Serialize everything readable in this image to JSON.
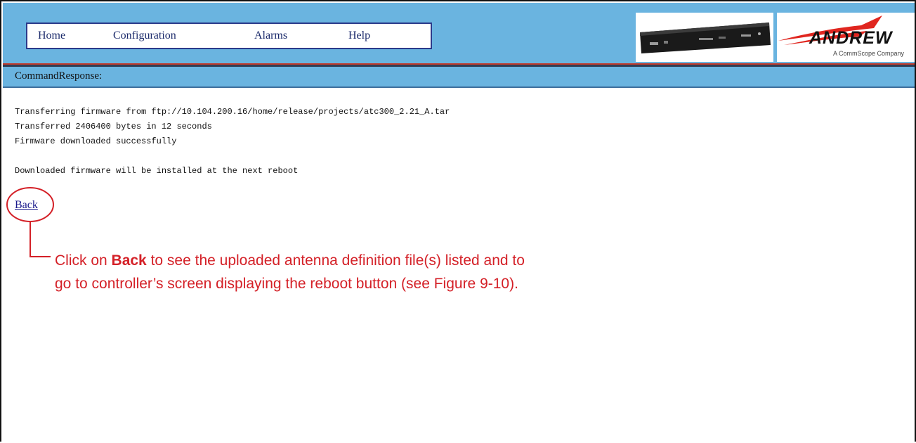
{
  "nav": {
    "home": "Home",
    "configuration": "Configuration",
    "alarms": "Alarms",
    "help": "Help"
  },
  "logo": {
    "brand": "ANDREW",
    "tagline": "A CommScope Company"
  },
  "command_response": {
    "label": "CommandResponse:",
    "lines": [
      "Transferring firmware from ftp://10.104.200.16/home/release/projects/atc300_2.21_A.tar",
      "Transferred 2406400 bytes in 12 seconds",
      "Firmware downloaded successfully",
      "Downloaded firmware will be installed at the next reboot"
    ]
  },
  "back_link": "Back",
  "callout": {
    "prefix": "Click on ",
    "bold": "Back",
    "suffix": " to see the uploaded antenna definition file(s) listed and to go to controller’s screen displaying the reboot button (see Figure 9-10)."
  },
  "colors": {
    "header_blue": "#6ab4e0",
    "callout_red": "#d42027",
    "nav_border": "#2b3a8a"
  }
}
